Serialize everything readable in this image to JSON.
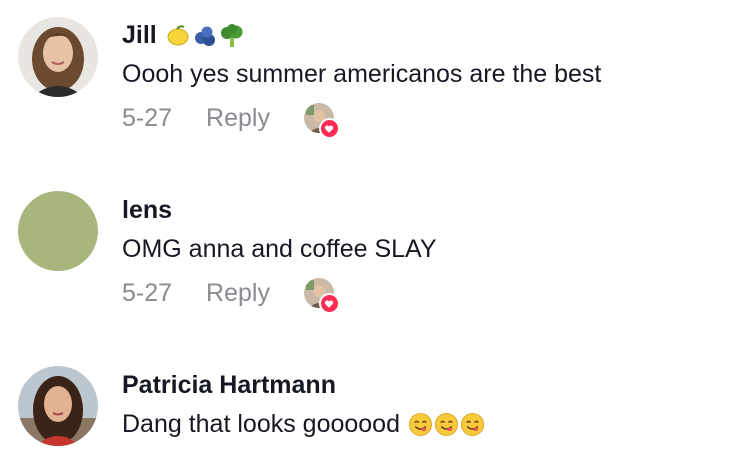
{
  "comments": [
    {
      "username": "Jill",
      "badges": [
        "lemon-icon",
        "blueberries-icon",
        "broccoli-icon"
      ],
      "text": "Oooh yes summer americanos are the best",
      "date": "5-27",
      "reply_label": "Reply",
      "liked_by_creator": true
    },
    {
      "username": "lens",
      "badges": [],
      "text": "OMG anna and coffee SLAY",
      "date": "5-27",
      "reply_label": "Reply",
      "liked_by_creator": true
    },
    {
      "username": "Patricia Hartmann",
      "badges": [],
      "text": "Dang that looks goooood",
      "text_emojis": [
        "yum-face-icon",
        "yum-face-icon",
        "yum-face-icon"
      ],
      "liked_by_creator": false
    }
  ],
  "colors": {
    "primary_text": "#161823",
    "secondary_text": "#8a8b91",
    "heart": "#fe2c55",
    "lens_avatar": "#a8b57d"
  }
}
